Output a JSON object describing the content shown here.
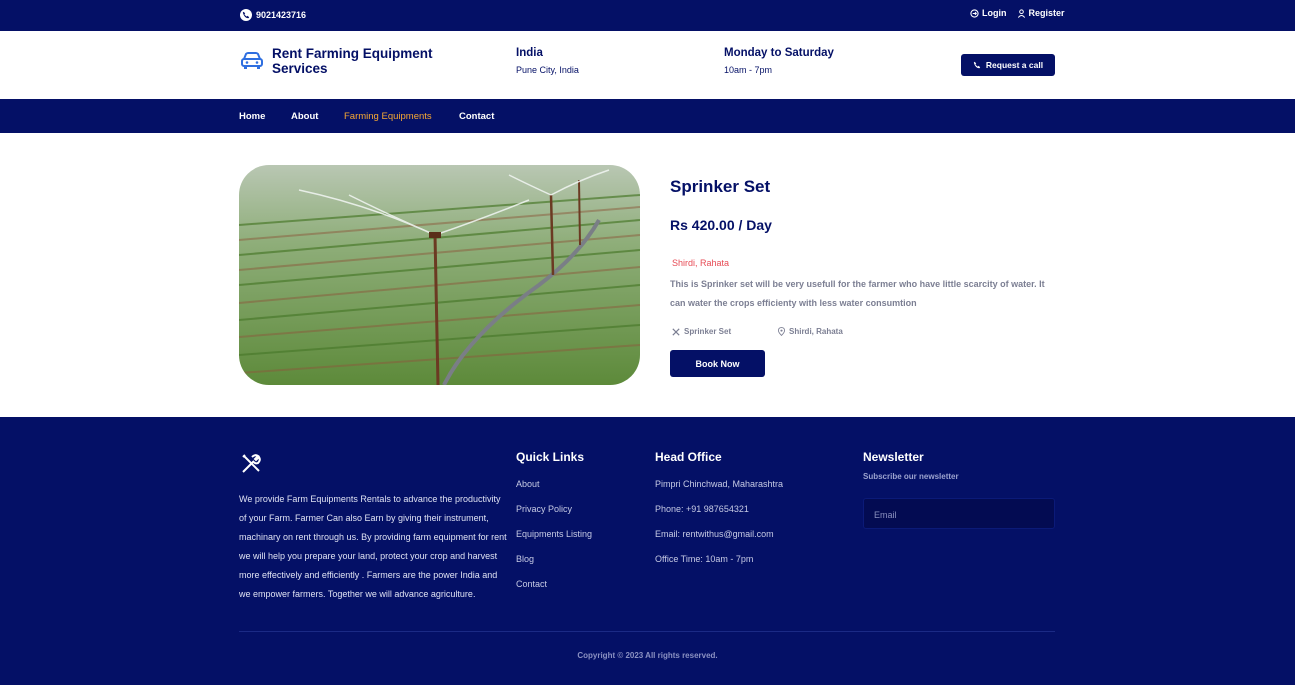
{
  "topbar": {
    "phone": "9021423716",
    "login": "Login",
    "register": "Register"
  },
  "header": {
    "brand": "Rent Farming Equipment Services",
    "country": "India",
    "city": "Pune City, India",
    "days": "Monday to Saturday",
    "hours": "10am - 7pm",
    "request_button": "Request a call"
  },
  "nav": {
    "items": [
      "Home",
      "About",
      "Farming Equipments",
      "Contact"
    ],
    "active": "Farming Equipments"
  },
  "product": {
    "title": "Sprinker Set",
    "price": "Rs 420.00 / Day",
    "location": "Shirdi, Rahata",
    "description": "This is Sprinker set will be very usefull for the farmer who have little scarcity of water. It can water the crops efficienty with less water consumtion",
    "meta_name": "Sprinker Set",
    "meta_location": "Shirdi, Rahata",
    "book_button": "Book Now"
  },
  "footer": {
    "about": "We provide Farm Equipments Rentals to advance the productivity of your Farm. Farmer Can also Earn by giving their instrument, machinary on rent through us. By providing farm equipment for rent we will help you prepare your land, protect your crop and harvest more effectively and efficiently . Farmers are the power India and we empower farmers. Together we will advance agriculture.",
    "quick_links": {
      "heading": "Quick Links",
      "items": [
        "About",
        "Privacy Policy",
        "Equipments Listing",
        "Blog",
        "Contact"
      ]
    },
    "head_office": {
      "heading": "Head Office",
      "items": [
        "Pimpri Chinchwad, Maharashtra",
        "Phone: +91 987654321",
        "Email: rentwithus@gmail.com",
        "Office Time: 10am - 7pm"
      ]
    },
    "newsletter": {
      "heading": "Newsletter",
      "subtitle": "Subscribe our newsletter",
      "placeholder": "Email"
    },
    "copyright": "Copyright © 2023 All rights reserved."
  },
  "colors": {
    "primary": "#041066",
    "accent": "#f7a833",
    "location": "#e74b55"
  }
}
